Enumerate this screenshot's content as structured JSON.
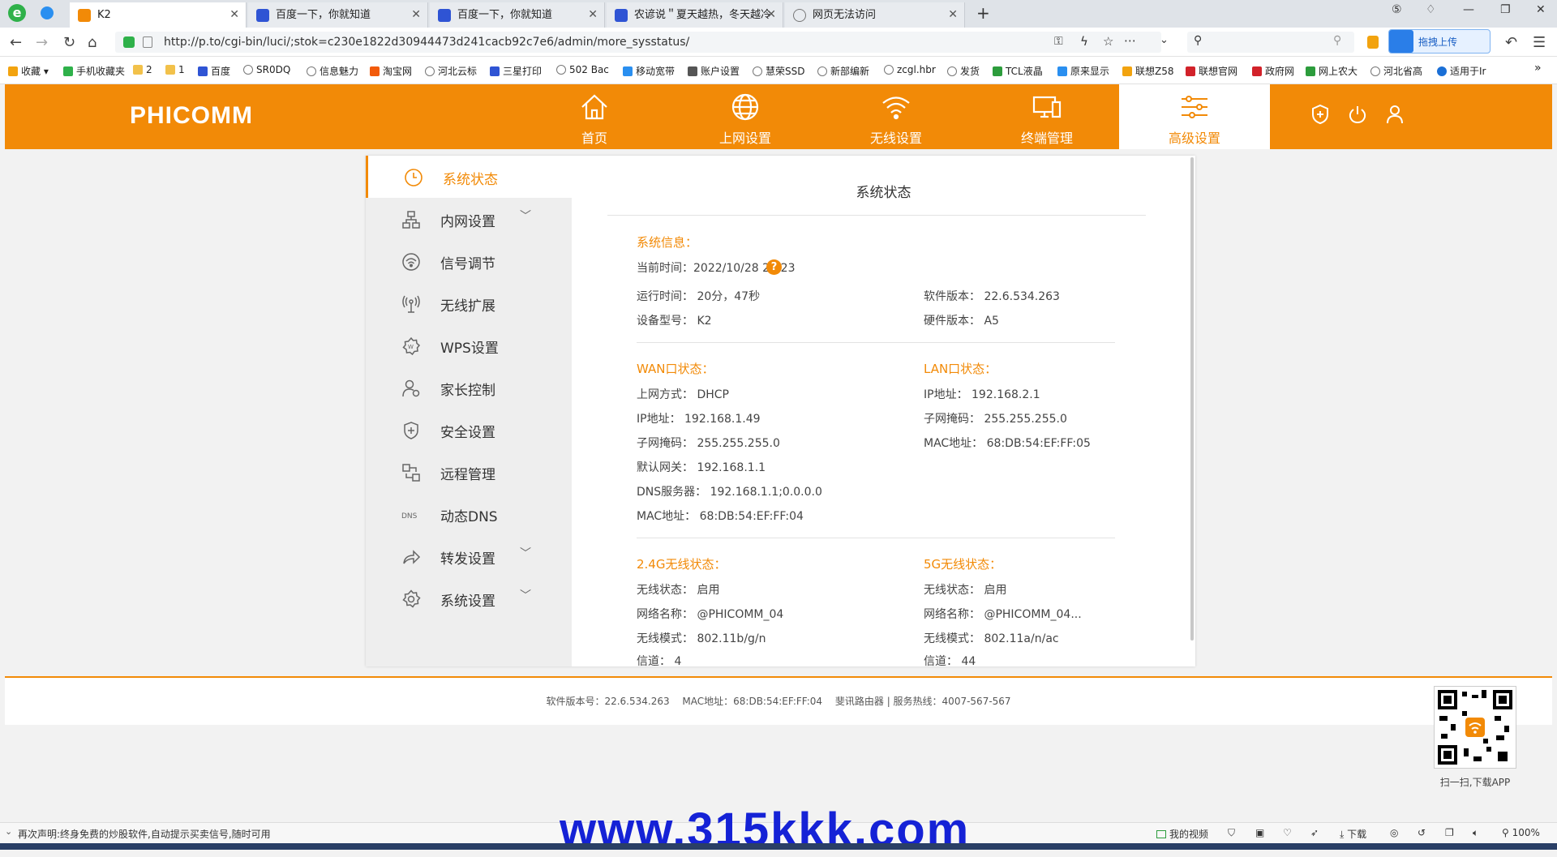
{
  "browser": {
    "tabs": [
      {
        "label": "K2",
        "active": true
      },
      {
        "label": "百度一下，你就知道",
        "active": false
      },
      {
        "label": "百度一下，你就知道",
        "active": false
      },
      {
        "label": "农谚说＂夏天越热，冬天越冷",
        "active": false
      },
      {
        "label": "网页无法访问",
        "active": false
      }
    ],
    "url": "http://p.to/cgi-bin/luci/;stok=c230e1822d30944473d241cacb92c7e6/admin/more_sysstatus/",
    "upload_label": "拖拽上传",
    "bookmarks": [
      "收藏",
      "手机收藏夹",
      "2",
      "1",
      "百度",
      "SR0DQ",
      "信息魅力",
      "淘宝网",
      "河北云标",
      "三星打印",
      "502 Bac",
      "移动宽带",
      "账户设置",
      "慧荣SSD",
      "新部编新",
      "zcgl.hbr",
      "发货",
      "TCL液晶",
      "原来显示",
      "联想Z58",
      "联想官网",
      "政府网",
      "网上农大",
      "河北省高",
      "适用于Ir"
    ]
  },
  "router": {
    "logo": "PHICOMM",
    "nav": [
      {
        "label": "首页",
        "icon": "home-icon"
      },
      {
        "label": "上网设置",
        "icon": "globe-icon"
      },
      {
        "label": "无线设置",
        "icon": "wifi-icon"
      },
      {
        "label": "终端管理",
        "icon": "devices-icon"
      },
      {
        "label": "高级设置",
        "icon": "sliders-icon",
        "active": true
      }
    ],
    "sidemenu": [
      {
        "label": "系统状态",
        "icon": "clock-icon",
        "active": true,
        "expandable": false
      },
      {
        "label": "内网设置",
        "icon": "network-icon",
        "expandable": true
      },
      {
        "label": "信号调节",
        "icon": "signal-icon",
        "expandable": false
      },
      {
        "label": "无线扩展",
        "icon": "antenna-icon",
        "expandable": false
      },
      {
        "label": "WPS设置",
        "icon": "wps-icon",
        "expandable": false
      },
      {
        "label": "家长控制",
        "icon": "parent-icon",
        "expandable": false
      },
      {
        "label": "安全设置",
        "icon": "shield-icon",
        "expandable": false
      },
      {
        "label": "远程管理",
        "icon": "remote-icon",
        "expandable": false
      },
      {
        "label": "动态DNS",
        "icon": "dns-icon",
        "expandable": false
      },
      {
        "label": "转发设置",
        "icon": "forward-icon",
        "expandable": true
      },
      {
        "label": "系统设置",
        "icon": "gear-icon",
        "expandable": true
      }
    ],
    "content": {
      "title": "系统状态",
      "sysinfo": {
        "heading": "系统信息：",
        "current_time": "当前时间：2022/10/28 21:23",
        "uptime": "运行时间： 20分，47秒",
        "model": "设备型号： K2",
        "software": "软件版本： 22.6.534.263",
        "hardware": "硬件版本： A5"
      },
      "wan": {
        "heading": "WAN口状态：",
        "rows": [
          "上网方式： DHCP",
          "IP地址： 192.168.1.49",
          "子网掩码： 255.255.255.0",
          "默认网关： 192.168.1.1",
          "DNS服务器： 192.168.1.1;0.0.0.0",
          "MAC地址： 68:DB:54:EF:FF:04"
        ]
      },
      "lan": {
        "heading": "LAN口状态：",
        "rows": [
          "IP地址： 192.168.2.1",
          "子网掩码： 255.255.255.0",
          "MAC地址： 68:DB:54:EF:FF:05"
        ]
      },
      "w24": {
        "heading": "2.4G无线状态：",
        "rows": [
          "无线状态： 启用",
          "网络名称： @PHICOMM_04",
          "无线模式： 802.11b/g/n",
          "信道： 4"
        ]
      },
      "w5": {
        "heading": "5G无线状态：",
        "rows": [
          "无线状态： 启用",
          "网络名称： @PHICOMM_04...",
          "无线模式： 802.11a/n/ac",
          "信道： 44"
        ]
      }
    },
    "footer": "软件版本号：22.6.534.263　 MAC地址：68:DB:54:EF:FF:04　 斐讯路由器 | 服务热线：4007-567-567",
    "qr_caption": "扫一扫,下载APP"
  },
  "statusbar": {
    "text": "再次声明:终身免费的炒股软件,自动提示买卖信号,随时可用",
    "video": "我的视频",
    "download": "下载",
    "zoom": "100%"
  },
  "watermark": "www.315kkk.com",
  "colors": {
    "brand": "#f28a07",
    "watermark": "#1522d6"
  }
}
